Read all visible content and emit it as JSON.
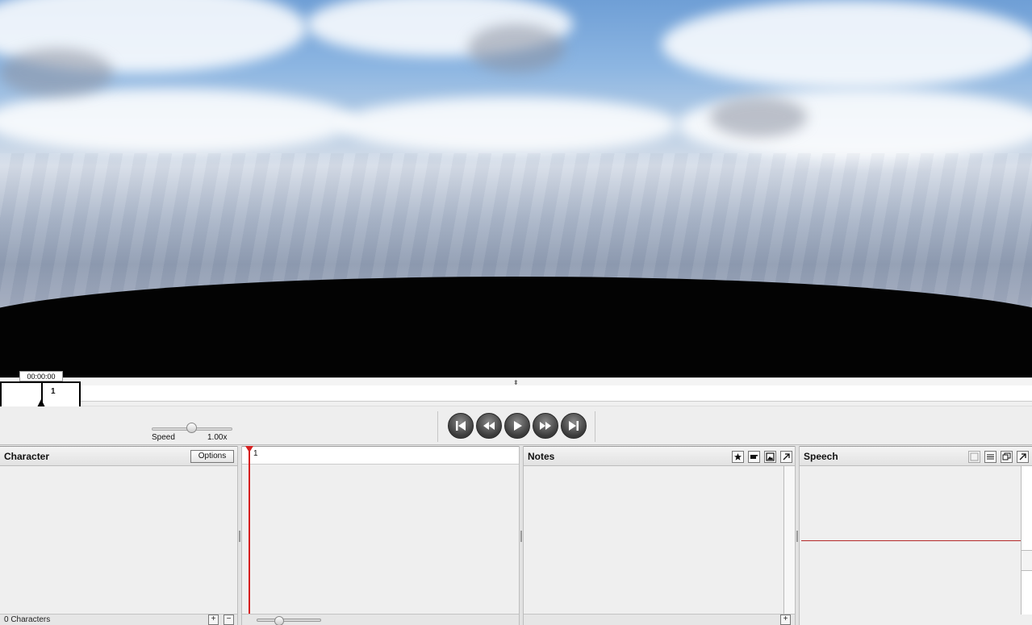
{
  "viewport": {
    "scene": "sky-over-dark-horizon"
  },
  "timeline": {
    "timecode": "00:00:00",
    "frame_number": "1"
  },
  "transport": {
    "speed_label": "Speed",
    "speed_value": "1.00x",
    "speed_level": 0.5,
    "buttons": [
      "previous-scene",
      "rewind",
      "play",
      "fast-forward",
      "next-scene"
    ]
  },
  "character_panel": {
    "title": "Character",
    "options_label": "Options",
    "footer": "0 Characters",
    "add_label": "+",
    "remove_label": "−"
  },
  "track_panel": {
    "frame_number": "1",
    "zoom_level": 0.35
  },
  "notes_panel": {
    "title": "Notes",
    "add_label": "+",
    "icons": [
      "star-icon",
      "hand-icon",
      "image-icon",
      "popout-icon"
    ]
  },
  "speech_panel": {
    "title": "Speech",
    "icons": [
      "blank-layout-icon",
      "lines-layout-icon",
      "window-icon",
      "popout-icon"
    ]
  },
  "colors": {
    "playhead": "#d62020",
    "speech_line": "#b52a2a"
  }
}
